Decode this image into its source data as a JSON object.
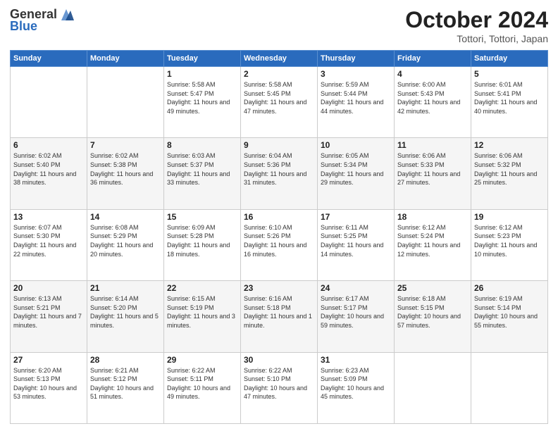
{
  "header": {
    "logo_general": "General",
    "logo_blue": "Blue",
    "month_year": "October 2024",
    "location": "Tottori, Tottori, Japan"
  },
  "days_of_week": [
    "Sunday",
    "Monday",
    "Tuesday",
    "Wednesday",
    "Thursday",
    "Friday",
    "Saturday"
  ],
  "weeks": [
    [
      {
        "day": "",
        "info": ""
      },
      {
        "day": "",
        "info": ""
      },
      {
        "day": "1",
        "info": "Sunrise: 5:58 AM\nSunset: 5:47 PM\nDaylight: 11 hours and 49 minutes."
      },
      {
        "day": "2",
        "info": "Sunrise: 5:58 AM\nSunset: 5:45 PM\nDaylight: 11 hours and 47 minutes."
      },
      {
        "day": "3",
        "info": "Sunrise: 5:59 AM\nSunset: 5:44 PM\nDaylight: 11 hours and 44 minutes."
      },
      {
        "day": "4",
        "info": "Sunrise: 6:00 AM\nSunset: 5:43 PM\nDaylight: 11 hours and 42 minutes."
      },
      {
        "day": "5",
        "info": "Sunrise: 6:01 AM\nSunset: 5:41 PM\nDaylight: 11 hours and 40 minutes."
      }
    ],
    [
      {
        "day": "6",
        "info": "Sunrise: 6:02 AM\nSunset: 5:40 PM\nDaylight: 11 hours and 38 minutes."
      },
      {
        "day": "7",
        "info": "Sunrise: 6:02 AM\nSunset: 5:38 PM\nDaylight: 11 hours and 36 minutes."
      },
      {
        "day": "8",
        "info": "Sunrise: 6:03 AM\nSunset: 5:37 PM\nDaylight: 11 hours and 33 minutes."
      },
      {
        "day": "9",
        "info": "Sunrise: 6:04 AM\nSunset: 5:36 PM\nDaylight: 11 hours and 31 minutes."
      },
      {
        "day": "10",
        "info": "Sunrise: 6:05 AM\nSunset: 5:34 PM\nDaylight: 11 hours and 29 minutes."
      },
      {
        "day": "11",
        "info": "Sunrise: 6:06 AM\nSunset: 5:33 PM\nDaylight: 11 hours and 27 minutes."
      },
      {
        "day": "12",
        "info": "Sunrise: 6:06 AM\nSunset: 5:32 PM\nDaylight: 11 hours and 25 minutes."
      }
    ],
    [
      {
        "day": "13",
        "info": "Sunrise: 6:07 AM\nSunset: 5:30 PM\nDaylight: 11 hours and 22 minutes."
      },
      {
        "day": "14",
        "info": "Sunrise: 6:08 AM\nSunset: 5:29 PM\nDaylight: 11 hours and 20 minutes."
      },
      {
        "day": "15",
        "info": "Sunrise: 6:09 AM\nSunset: 5:28 PM\nDaylight: 11 hours and 18 minutes."
      },
      {
        "day": "16",
        "info": "Sunrise: 6:10 AM\nSunset: 5:26 PM\nDaylight: 11 hours and 16 minutes."
      },
      {
        "day": "17",
        "info": "Sunrise: 6:11 AM\nSunset: 5:25 PM\nDaylight: 11 hours and 14 minutes."
      },
      {
        "day": "18",
        "info": "Sunrise: 6:12 AM\nSunset: 5:24 PM\nDaylight: 11 hours and 12 minutes."
      },
      {
        "day": "19",
        "info": "Sunrise: 6:12 AM\nSunset: 5:23 PM\nDaylight: 11 hours and 10 minutes."
      }
    ],
    [
      {
        "day": "20",
        "info": "Sunrise: 6:13 AM\nSunset: 5:21 PM\nDaylight: 11 hours and 7 minutes."
      },
      {
        "day": "21",
        "info": "Sunrise: 6:14 AM\nSunset: 5:20 PM\nDaylight: 11 hours and 5 minutes."
      },
      {
        "day": "22",
        "info": "Sunrise: 6:15 AM\nSunset: 5:19 PM\nDaylight: 11 hours and 3 minutes."
      },
      {
        "day": "23",
        "info": "Sunrise: 6:16 AM\nSunset: 5:18 PM\nDaylight: 11 hours and 1 minute."
      },
      {
        "day": "24",
        "info": "Sunrise: 6:17 AM\nSunset: 5:17 PM\nDaylight: 10 hours and 59 minutes."
      },
      {
        "day": "25",
        "info": "Sunrise: 6:18 AM\nSunset: 5:15 PM\nDaylight: 10 hours and 57 minutes."
      },
      {
        "day": "26",
        "info": "Sunrise: 6:19 AM\nSunset: 5:14 PM\nDaylight: 10 hours and 55 minutes."
      }
    ],
    [
      {
        "day": "27",
        "info": "Sunrise: 6:20 AM\nSunset: 5:13 PM\nDaylight: 10 hours and 53 minutes."
      },
      {
        "day": "28",
        "info": "Sunrise: 6:21 AM\nSunset: 5:12 PM\nDaylight: 10 hours and 51 minutes."
      },
      {
        "day": "29",
        "info": "Sunrise: 6:22 AM\nSunset: 5:11 PM\nDaylight: 10 hours and 49 minutes."
      },
      {
        "day": "30",
        "info": "Sunrise: 6:22 AM\nSunset: 5:10 PM\nDaylight: 10 hours and 47 minutes."
      },
      {
        "day": "31",
        "info": "Sunrise: 6:23 AM\nSunset: 5:09 PM\nDaylight: 10 hours and 45 minutes."
      },
      {
        "day": "",
        "info": ""
      },
      {
        "day": "",
        "info": ""
      }
    ]
  ]
}
